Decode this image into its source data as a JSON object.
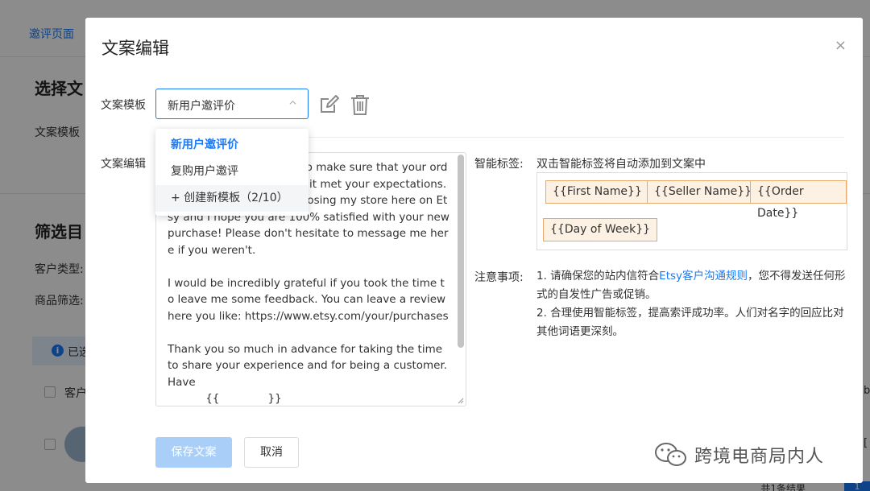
{
  "background": {
    "breadcrumb": "邀评页面",
    "section1_title": "选择文",
    "section1_label": "文案模板",
    "section2_title": "筛选目",
    "customer_type_label": "客户类型:",
    "product_filter_label": "商品筛选:",
    "alert_text": "已选",
    "table_header_fragment": "客户",
    "right_fragment_1": "b",
    "right_fragment_2": "[",
    "pager_text": "共1条结果",
    "pager_page": "1"
  },
  "modal": {
    "title": "文案编辑",
    "close_glyph": "×",
    "template_label": "文案模板",
    "template_selected": "新用户邀评价",
    "template_options": [
      "新用户邀评价",
      "复购用户邀评",
      "+ 创建新模板（2/10）"
    ],
    "editor_label": "文案编辑",
    "editor_text": "                                        o make sure that your order arrived safely and that it met your expectations. I truly appreciate you choosing my store here on Etsy and I hope you are 100% satisfied with your new purchase! Please don't hesitate to message me here if you weren't.\n\nI would be incredibly grateful if you took the time to leave me some feedback. You can leave a review here you like: https://www.etsy.com/your/purchases\n\nThank you so much in advance for taking the time to share your experience and for being a customer. Have\n           {{              }}",
    "smart_tag_label": "智能标签:",
    "smart_tag_hint": "双击智能标签将自动添加到文案中",
    "tags": [
      "{{First Name}}",
      "{{Seller Name}}",
      "{{Order Date}}",
      "{{Day of Week}}"
    ],
    "notes_label": "注意事项:",
    "note1_prefix": "1. 请确保您的站内信符合",
    "note1_link": "Etsy客户沟通规则",
    "note1_suffix": "，您不得发送任何形式的自发性广告或促销。",
    "note2": "2. 合理使用智能标签，提高索评成功率。人们对名字的回应比对其他词语更深刻。",
    "save_label": "保存文案",
    "cancel_label": "取消"
  },
  "watermark": {
    "text": "跨境电商局内人",
    "icon": "wechat-icon"
  },
  "colors": {
    "accent": "#1a7af8",
    "tag_border": "#e8a867",
    "tag_bg": "#fdf1e3",
    "save_disabled": "#a9cff9"
  }
}
